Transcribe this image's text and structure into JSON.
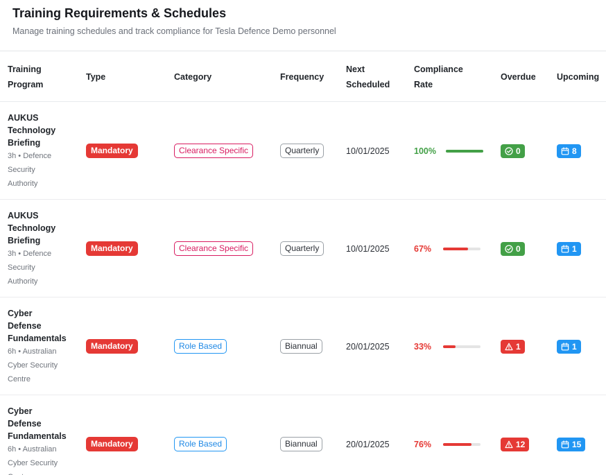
{
  "header": {
    "title": "Training Requirements & Schedules",
    "subtitle": "Manage training schedules and track compliance for Tesla Defence Demo personnel"
  },
  "columns": {
    "program": "Training Program",
    "type": "Type",
    "category": "Category",
    "frequency": "Frequency",
    "next": "Next Scheduled",
    "compliance": "Compliance Rate",
    "overdue": "Overdue",
    "upcoming": "Upcoming"
  },
  "colors": {
    "mandatory": "#e53935",
    "clearance": "#d81b60",
    "role": "#2196f3",
    "good": "#43a047",
    "bad": "#e53935"
  },
  "rows": [
    {
      "title_lines": [
        "AUKUS",
        "Technology",
        "Briefing"
      ],
      "meta_lines": [
        "3h • Defence",
        "Security",
        "Authority"
      ],
      "type": "Mandatory",
      "category": "Clearance Specific",
      "category_kind": "clearance",
      "frequency": "Quarterly",
      "next": "10/01/2025",
      "rate_label": "100%",
      "rate": 1.0,
      "overdue": "0",
      "overdue_kind": "ok",
      "upcoming": "8"
    },
    {
      "title_lines": [
        "AUKUS",
        "Technology",
        "Briefing"
      ],
      "meta_lines": [
        "3h • Defence",
        "Security",
        "Authority"
      ],
      "type": "Mandatory",
      "category": "Clearance Specific",
      "category_kind": "clearance",
      "frequency": "Quarterly",
      "next": "10/01/2025",
      "rate_label": "67%",
      "rate": 0.67,
      "overdue": "0",
      "overdue_kind": "ok",
      "upcoming": "1"
    },
    {
      "title_lines": [
        "Cyber",
        "Defense",
        "Fundamentals"
      ],
      "meta_lines": [
        "6h • Australian",
        "Cyber Security",
        "Centre"
      ],
      "type": "Mandatory",
      "category": "Role Based",
      "category_kind": "role",
      "frequency": "Biannual",
      "next": "20/01/2025",
      "rate_label": "33%",
      "rate": 0.33,
      "overdue": "1",
      "overdue_kind": "warn",
      "upcoming": "1"
    },
    {
      "title_lines": [
        "Cyber",
        "Defense",
        "Fundamentals"
      ],
      "meta_lines": [
        "6h • Australian",
        "Cyber Security",
        "Centre"
      ],
      "type": "Mandatory",
      "category": "Role Based",
      "category_kind": "role",
      "frequency": "Biannual",
      "next": "20/01/2025",
      "rate_label": "76%",
      "rate": 0.76,
      "overdue": "12",
      "overdue_kind": "warn",
      "upcoming": "15"
    }
  ]
}
